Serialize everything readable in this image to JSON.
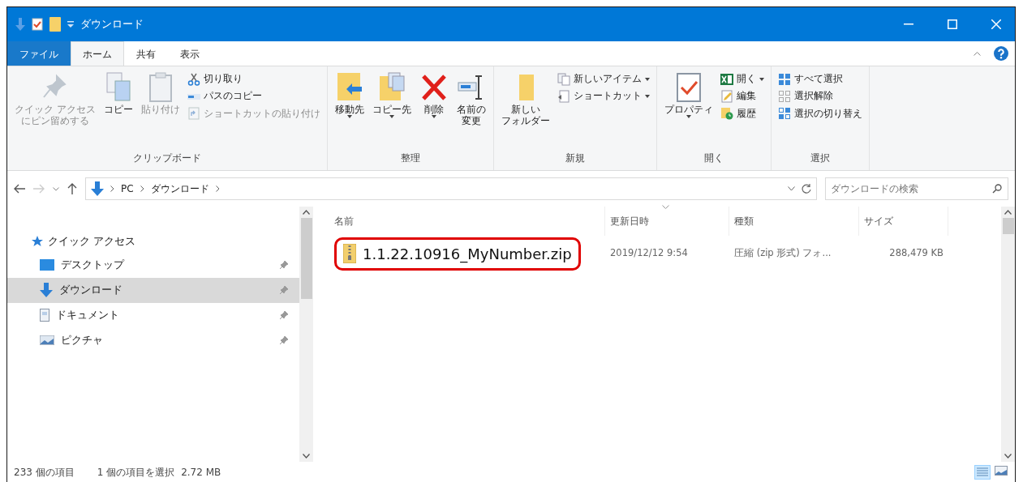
{
  "window": {
    "title": "ダウンロード"
  },
  "tabs": [
    {
      "label": "ファイル",
      "kind": "file",
      "selected": false
    },
    {
      "label": "ホーム",
      "kind": "normal",
      "selected": true
    },
    {
      "label": "共有",
      "kind": "normal",
      "selected": false
    },
    {
      "label": "表示",
      "kind": "normal",
      "selected": false
    }
  ],
  "ribbon": {
    "groups": [
      {
        "label": "クリップボード",
        "items": [
          {
            "kind": "large",
            "lines": [
              "クイック アクセス",
              "にピン留めする"
            ],
            "disabled": true,
            "has_menu": false
          },
          {
            "kind": "large",
            "label": "コピー",
            "disabled": false,
            "has_menu": false
          },
          {
            "kind": "large",
            "label": "貼り付け",
            "disabled": true,
            "has_menu": false
          },
          {
            "kind": "small",
            "label": "切り取り",
            "disabled": false,
            "has_menu": false
          },
          {
            "kind": "small",
            "label": "パスのコピー",
            "disabled": false,
            "has_menu": false
          },
          {
            "kind": "small",
            "label": "ショートカットの貼り付け",
            "disabled": true,
            "has_menu": false
          }
        ]
      },
      {
        "label": "整理",
        "items": [
          {
            "kind": "large",
            "label": "移動先",
            "disabled": false,
            "has_menu": true
          },
          {
            "kind": "large",
            "label": "コピー先",
            "disabled": false,
            "has_menu": true
          },
          {
            "kind": "large",
            "label": "削除",
            "disabled": false,
            "has_menu": true
          },
          {
            "kind": "large",
            "lines": [
              "名前の",
              "変更"
            ],
            "disabled": false,
            "has_menu": false
          }
        ]
      },
      {
        "label": "新規",
        "items": [
          {
            "kind": "large",
            "lines": [
              "新しい",
              "フォルダー"
            ],
            "disabled": false,
            "has_menu": false
          },
          {
            "kind": "small",
            "label": "新しいアイテム",
            "disabled": false,
            "has_menu": true
          },
          {
            "kind": "small",
            "label": "ショートカット",
            "disabled": false,
            "has_menu": true
          }
        ]
      },
      {
        "label": "開く",
        "items": [
          {
            "kind": "large",
            "label": "プロパティ",
            "disabled": false,
            "has_menu": true
          },
          {
            "kind": "small",
            "label": "開く",
            "disabled": false,
            "has_menu": true
          },
          {
            "kind": "small",
            "label": "編集",
            "disabled": false,
            "has_menu": false
          },
          {
            "kind": "small",
            "label": "履歴",
            "disabled": false,
            "has_menu": false
          }
        ]
      },
      {
        "label": "選択",
        "items": [
          {
            "kind": "small",
            "label": "すべて選択",
            "disabled": false,
            "has_menu": false
          },
          {
            "kind": "small",
            "label": "選択解除",
            "disabled": false,
            "has_menu": false
          },
          {
            "kind": "small",
            "label": "選択の切り替え",
            "disabled": false,
            "has_menu": false
          }
        ]
      }
    ]
  },
  "address": {
    "crumbs": [
      "PC",
      "ダウンロード"
    ]
  },
  "search": {
    "placeholder": "ダウンロードの検索"
  },
  "nav": {
    "header": "クイック アクセス",
    "items": [
      {
        "label": "デスクトップ",
        "selected": false,
        "pinned": true
      },
      {
        "label": "ダウンロード",
        "selected": true,
        "pinned": true
      },
      {
        "label": "ドキュメント",
        "selected": false,
        "pinned": true
      },
      {
        "label": "ピクチャ",
        "selected": false,
        "pinned": true
      }
    ]
  },
  "table": {
    "columns": [
      "名前",
      "更新日時",
      "種類",
      "サイズ"
    ],
    "rows": [
      {
        "name": "1.1.22.10916_MyNumber.zip",
        "modified": "2019/12/12 9:54",
        "type": "圧縮 (zip 形式) フォ...",
        "size": "288,479 KB",
        "highlighted": true
      }
    ]
  },
  "status_bar": {
    "count": "233 個の項目",
    "selection": "1 個の項目を選択",
    "size": "2.72 MB"
  }
}
